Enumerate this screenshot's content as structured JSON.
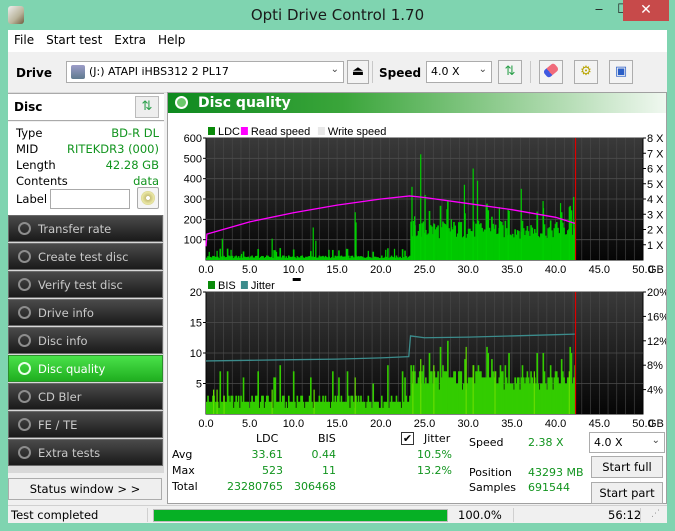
{
  "window": {
    "title": "Opti Drive Control 1.70",
    "minimize": "‒",
    "maximize": "☐",
    "close": "✕"
  },
  "menu": [
    "File",
    "Start test",
    "Extra",
    "Help"
  ],
  "toolbar": {
    "drive_label": "Drive",
    "drive_value": "(J:)   ATAPI iHBS312   2 PL17",
    "speed_label": "Speed",
    "speed_value": "4.0 X",
    "icons": [
      "eject-icon",
      "refresh-icon",
      "eraser-icon",
      "settings-icon",
      "save-icon"
    ]
  },
  "disc": {
    "header": "Disc",
    "rows": [
      {
        "k": "Type",
        "v": "BD-R DL"
      },
      {
        "k": "MID",
        "v": "RITEKDR3 (000)"
      },
      {
        "k": "Length",
        "v": "42.28 GB"
      },
      {
        "k": "Contents",
        "v": "data"
      }
    ],
    "label_label": "Label",
    "label_value": ""
  },
  "nav": [
    {
      "label": "Transfer rate",
      "active": false
    },
    {
      "label": "Create test disc",
      "active": false
    },
    {
      "label": "Verify test disc",
      "active": false
    },
    {
      "label": "Drive info",
      "active": false
    },
    {
      "label": "Disc info",
      "active": false
    },
    {
      "label": "Disc quality",
      "active": true
    },
    {
      "label": "CD Bler",
      "active": false
    },
    {
      "label": "FE / TE",
      "active": false
    },
    {
      "label": "Extra tests",
      "active": false
    }
  ],
  "status_window_button": "Status window > >",
  "panel": {
    "title": "Disc quality"
  },
  "chart_data": [
    {
      "type": "bar",
      "title": "LDC / Read speed",
      "legend": [
        "LDC",
        "Read speed",
        "Write speed"
      ],
      "legend_colors": [
        "#0a8a0a",
        "#ff00ff",
        "#e8e8e8"
      ],
      "xlabel": "GB",
      "x_ticks": [
        "0.0",
        "5.0",
        "10.0",
        "15.0",
        "20.0",
        "25.0",
        "30.0",
        "35.0",
        "40.0",
        "45.0",
        "50.0"
      ],
      "xlim": [
        0,
        50
      ],
      "ylim": [
        0,
        600
      ],
      "y_ticks": [
        "100",
        "200",
        "300",
        "400",
        "500",
        "600"
      ],
      "y2_ticks": [
        "1 X",
        "2 X",
        "3 X",
        "4 X",
        "5 X",
        "6 X",
        "7 X",
        "8 X"
      ],
      "y2lim": [
        0,
        8
      ],
      "end_marker_gb": 42.28,
      "ldc_layer0_baseline": 15,
      "ldc_layer1_baseline": 150,
      "ldc_layer_break_gb": 23.3,
      "ldc_spikes": [
        [
          0.3,
          40
        ],
        [
          1.2,
          45
        ],
        [
          1.8,
          105
        ],
        [
          2.8,
          50
        ],
        [
          4.0,
          30
        ],
        [
          7.5,
          105
        ],
        [
          8.0,
          40
        ],
        [
          12.2,
          160
        ],
        [
          12.5,
          95
        ],
        [
          14.0,
          50
        ],
        [
          16.0,
          55
        ],
        [
          17.0,
          235
        ],
        [
          17.1,
          185
        ],
        [
          18.5,
          45
        ],
        [
          20.5,
          50
        ],
        [
          21.5,
          55
        ],
        [
          23.5,
          360
        ],
        [
          23.8,
          215
        ],
        [
          24.5,
          520
        ],
        [
          25.0,
          320
        ],
        [
          26.0,
          180
        ],
        [
          27.5,
          250
        ],
        [
          28.0,
          200
        ],
        [
          29.5,
          370
        ],
        [
          30.5,
          450
        ],
        [
          31.0,
          390
        ],
        [
          32.0,
          270
        ],
        [
          33.5,
          260
        ],
        [
          34.5,
          250
        ],
        [
          36.0,
          350
        ],
        [
          38.5,
          290
        ],
        [
          40.5,
          280
        ],
        [
          41.5,
          260
        ],
        [
          42.0,
          310
        ]
      ],
      "read_speed_x": [
        [
          0,
          0.9
        ],
        [
          0.1,
          1.7
        ],
        [
          5,
          2.5
        ],
        [
          10,
          3.1
        ],
        [
          15,
          3.6
        ],
        [
          20,
          4.0
        ],
        [
          23.3,
          4.2
        ],
        [
          25,
          4.1
        ],
        [
          30,
          3.7
        ],
        [
          35,
          3.3
        ],
        [
          40,
          2.8
        ],
        [
          42.2,
          2.4
        ]
      ]
    },
    {
      "type": "bar",
      "title": "BIS / Jitter",
      "legend": [
        "BIS",
        "Jitter"
      ],
      "legend_colors": [
        "#0a8a0a",
        "#3c8c8c"
      ],
      "xlabel": "GB",
      "x_ticks": [
        "0.0",
        "5.0",
        "10.0",
        "15.0",
        "20.0",
        "25.0",
        "30.0",
        "35.0",
        "40.0",
        "45.0",
        "50.0"
      ],
      "xlim": [
        0,
        50
      ],
      "ylim": [
        0,
        20
      ],
      "y_ticks": [
        "5",
        "10",
        "15",
        "20"
      ],
      "y2_ticks": [
        "4%",
        "8%",
        "12%",
        "16%",
        "20%"
      ],
      "y2lim": [
        0,
        20
      ],
      "end_marker_gb": 42.28,
      "bis_layer0_baseline": 2,
      "bis_layer1_baseline": 6,
      "bis_layer_break_gb": 23.3,
      "bis_spikes": [
        [
          0.8,
          4
        ],
        [
          1.2,
          4
        ],
        [
          2.0,
          3
        ],
        [
          7.5,
          4
        ],
        [
          12.3,
          4
        ],
        [
          17.0,
          6
        ],
        [
          23.6,
          7
        ],
        [
          24.5,
          9
        ],
        [
          26.0,
          8
        ],
        [
          29.7,
          11
        ],
        [
          30.5,
          8
        ],
        [
          33.0,
          7
        ],
        [
          37.5,
          7
        ],
        [
          41.5,
          7
        ]
      ],
      "jitter_pct": [
        [
          0,
          8.7
        ],
        [
          5,
          8.8
        ],
        [
          10,
          8.9
        ],
        [
          15,
          9.0
        ],
        [
          20,
          9.2
        ],
        [
          23.2,
          9.4
        ],
        [
          23.4,
          12.8
        ],
        [
          25,
          12.5
        ],
        [
          30,
          12.6
        ],
        [
          35,
          12.8
        ],
        [
          40,
          13.0
        ],
        [
          42.2,
          13.1
        ]
      ]
    }
  ],
  "stats": {
    "col_ldc": "LDC",
    "col_bis": "BIS",
    "jitter_label": "Jitter",
    "jitter_checked": true,
    "rows": [
      {
        "label": "Avg",
        "ldc": "33.61",
        "bis": "0.44",
        "jitter": "10.5%"
      },
      {
        "label": "Max",
        "ldc": "523",
        "bis": "11",
        "jitter": "13.2%"
      },
      {
        "label": "Total",
        "ldc": "23280765",
        "bis": "306468",
        "jitter": ""
      }
    ],
    "speed_label": "Speed",
    "speed_value": "2.38 X",
    "position_label": "Position",
    "position_value": "43293 MB",
    "samples_label": "Samples",
    "samples_value": "691544",
    "speed_select": "4.0 X",
    "start_full": "Start full",
    "start_part": "Start part"
  },
  "statusbar": {
    "text": "Test completed",
    "progress_pct": 100.0,
    "progress_text": "100.0%",
    "elapsed": "56:12"
  }
}
